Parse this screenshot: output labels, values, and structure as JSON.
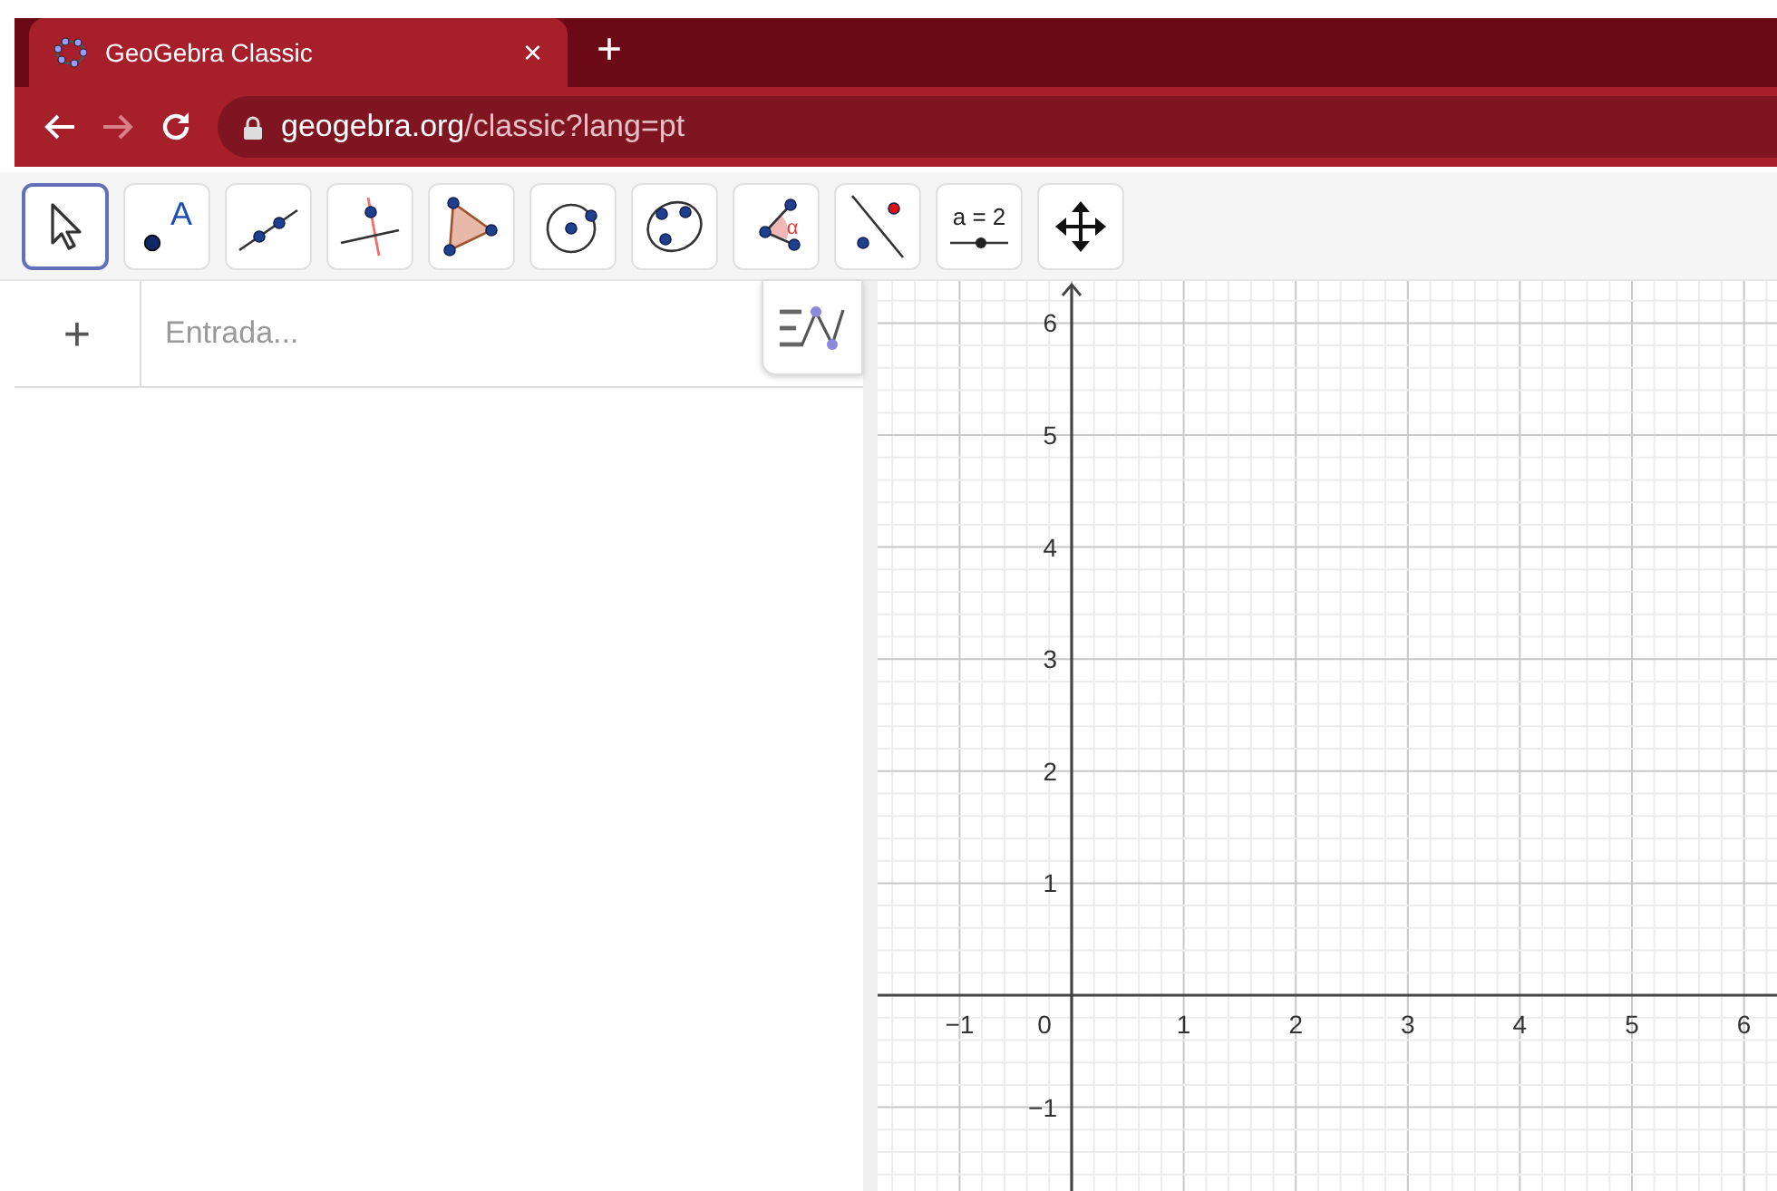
{
  "browser": {
    "tab": {
      "title": "GeoGebra Classic",
      "close": "×",
      "selected": true
    },
    "new_tab": "+",
    "forward_disabled": true,
    "url": {
      "host": "geogebra.org",
      "path": "/classic?lang=pt"
    }
  },
  "toolbar": {
    "tools": [
      {
        "kind": "move",
        "selected": true
      },
      {
        "kind": "point",
        "label": "A",
        "selected": false
      },
      {
        "kind": "line",
        "selected": false
      },
      {
        "kind": "perpendicular",
        "selected": false
      },
      {
        "kind": "polygon",
        "selected": false
      },
      {
        "kind": "circle",
        "selected": false
      },
      {
        "kind": "conic",
        "selected": false
      },
      {
        "kind": "angle",
        "label": "α",
        "selected": false
      },
      {
        "kind": "reflect",
        "selected": false
      },
      {
        "kind": "slider",
        "label": "a = 2",
        "selected": false
      },
      {
        "kind": "pan",
        "selected": false
      }
    ]
  },
  "algebra": {
    "add": "+",
    "input": {
      "placeholder": "Entrada..."
    }
  },
  "graphics": {
    "x_labels": [
      "−1",
      "0",
      "1",
      "2",
      "3",
      "4",
      "5",
      "6"
    ],
    "y_labels": [
      "6",
      "5",
      "4",
      "3",
      "2",
      "1",
      "−1"
    ]
  }
}
